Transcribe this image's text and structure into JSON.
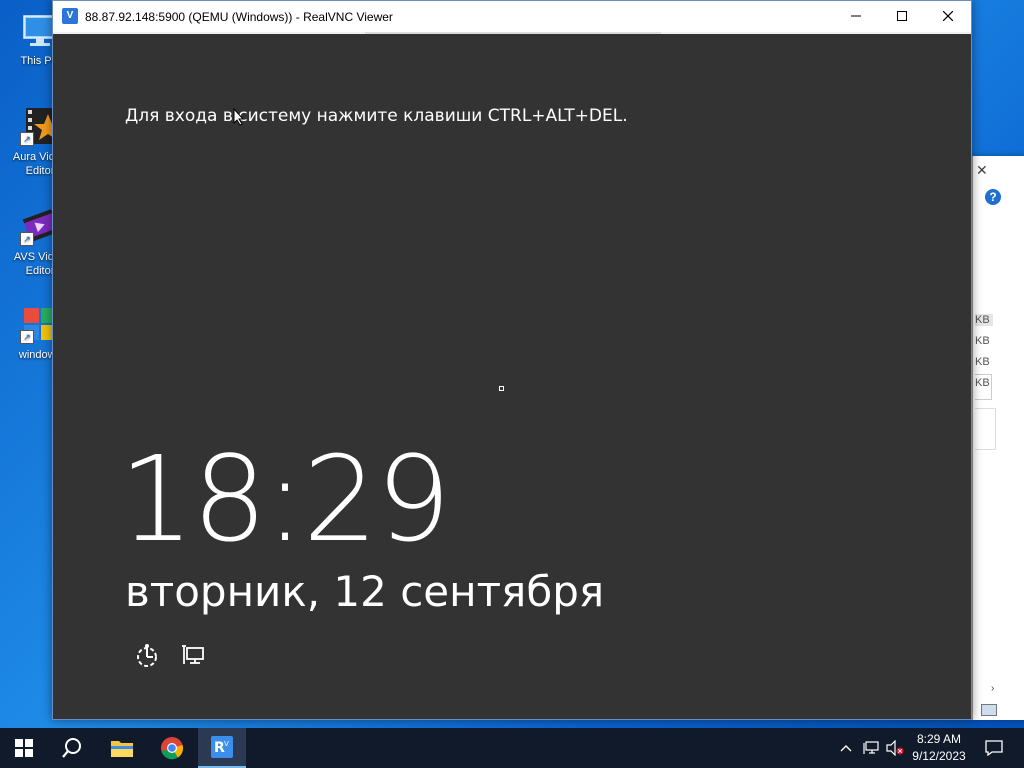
{
  "desktop": {
    "icons": [
      {
        "label": "This PC",
        "icon": "this-pc-icon"
      },
      {
        "label": "Aura Video Editor",
        "icon": "aura-video-editor-icon"
      },
      {
        "label": "AVS Video Editor",
        "icon": "avs-video-editor-icon"
      },
      {
        "label": "windows",
        "icon": "windows-app-icon"
      }
    ]
  },
  "background_window": {
    "close_glyph": "✕",
    "help_glyph": "?",
    "file_sizes": [
      "KB",
      "KB",
      "KB",
      "KB"
    ],
    "scroll_glyph": "›"
  },
  "vnc_window": {
    "title": "88.87.92.148:5900 (QEMU (Windows)) - RealVNC Viewer",
    "app_icon": "realvnc-icon",
    "controls": {
      "minimize": "—",
      "maximize": "☐",
      "close": "✕"
    }
  },
  "lock_screen": {
    "prompt": "Для входа в систему нажмите клавиши CTRL+ALT+DEL.",
    "time": "18:29",
    "date": "вторник, 12 сентября",
    "icons": [
      "ease-of-access-icon",
      "network-icon"
    ],
    "background_color": "#333333"
  },
  "taskbar": {
    "buttons": [
      "start-button",
      "search-button",
      "file-explorer-button",
      "chrome-button",
      "realvnc-taskbar-button"
    ],
    "tray": {
      "time": "8:29 AM",
      "date": "9/12/2023"
    },
    "accent": "#76b9ed"
  }
}
